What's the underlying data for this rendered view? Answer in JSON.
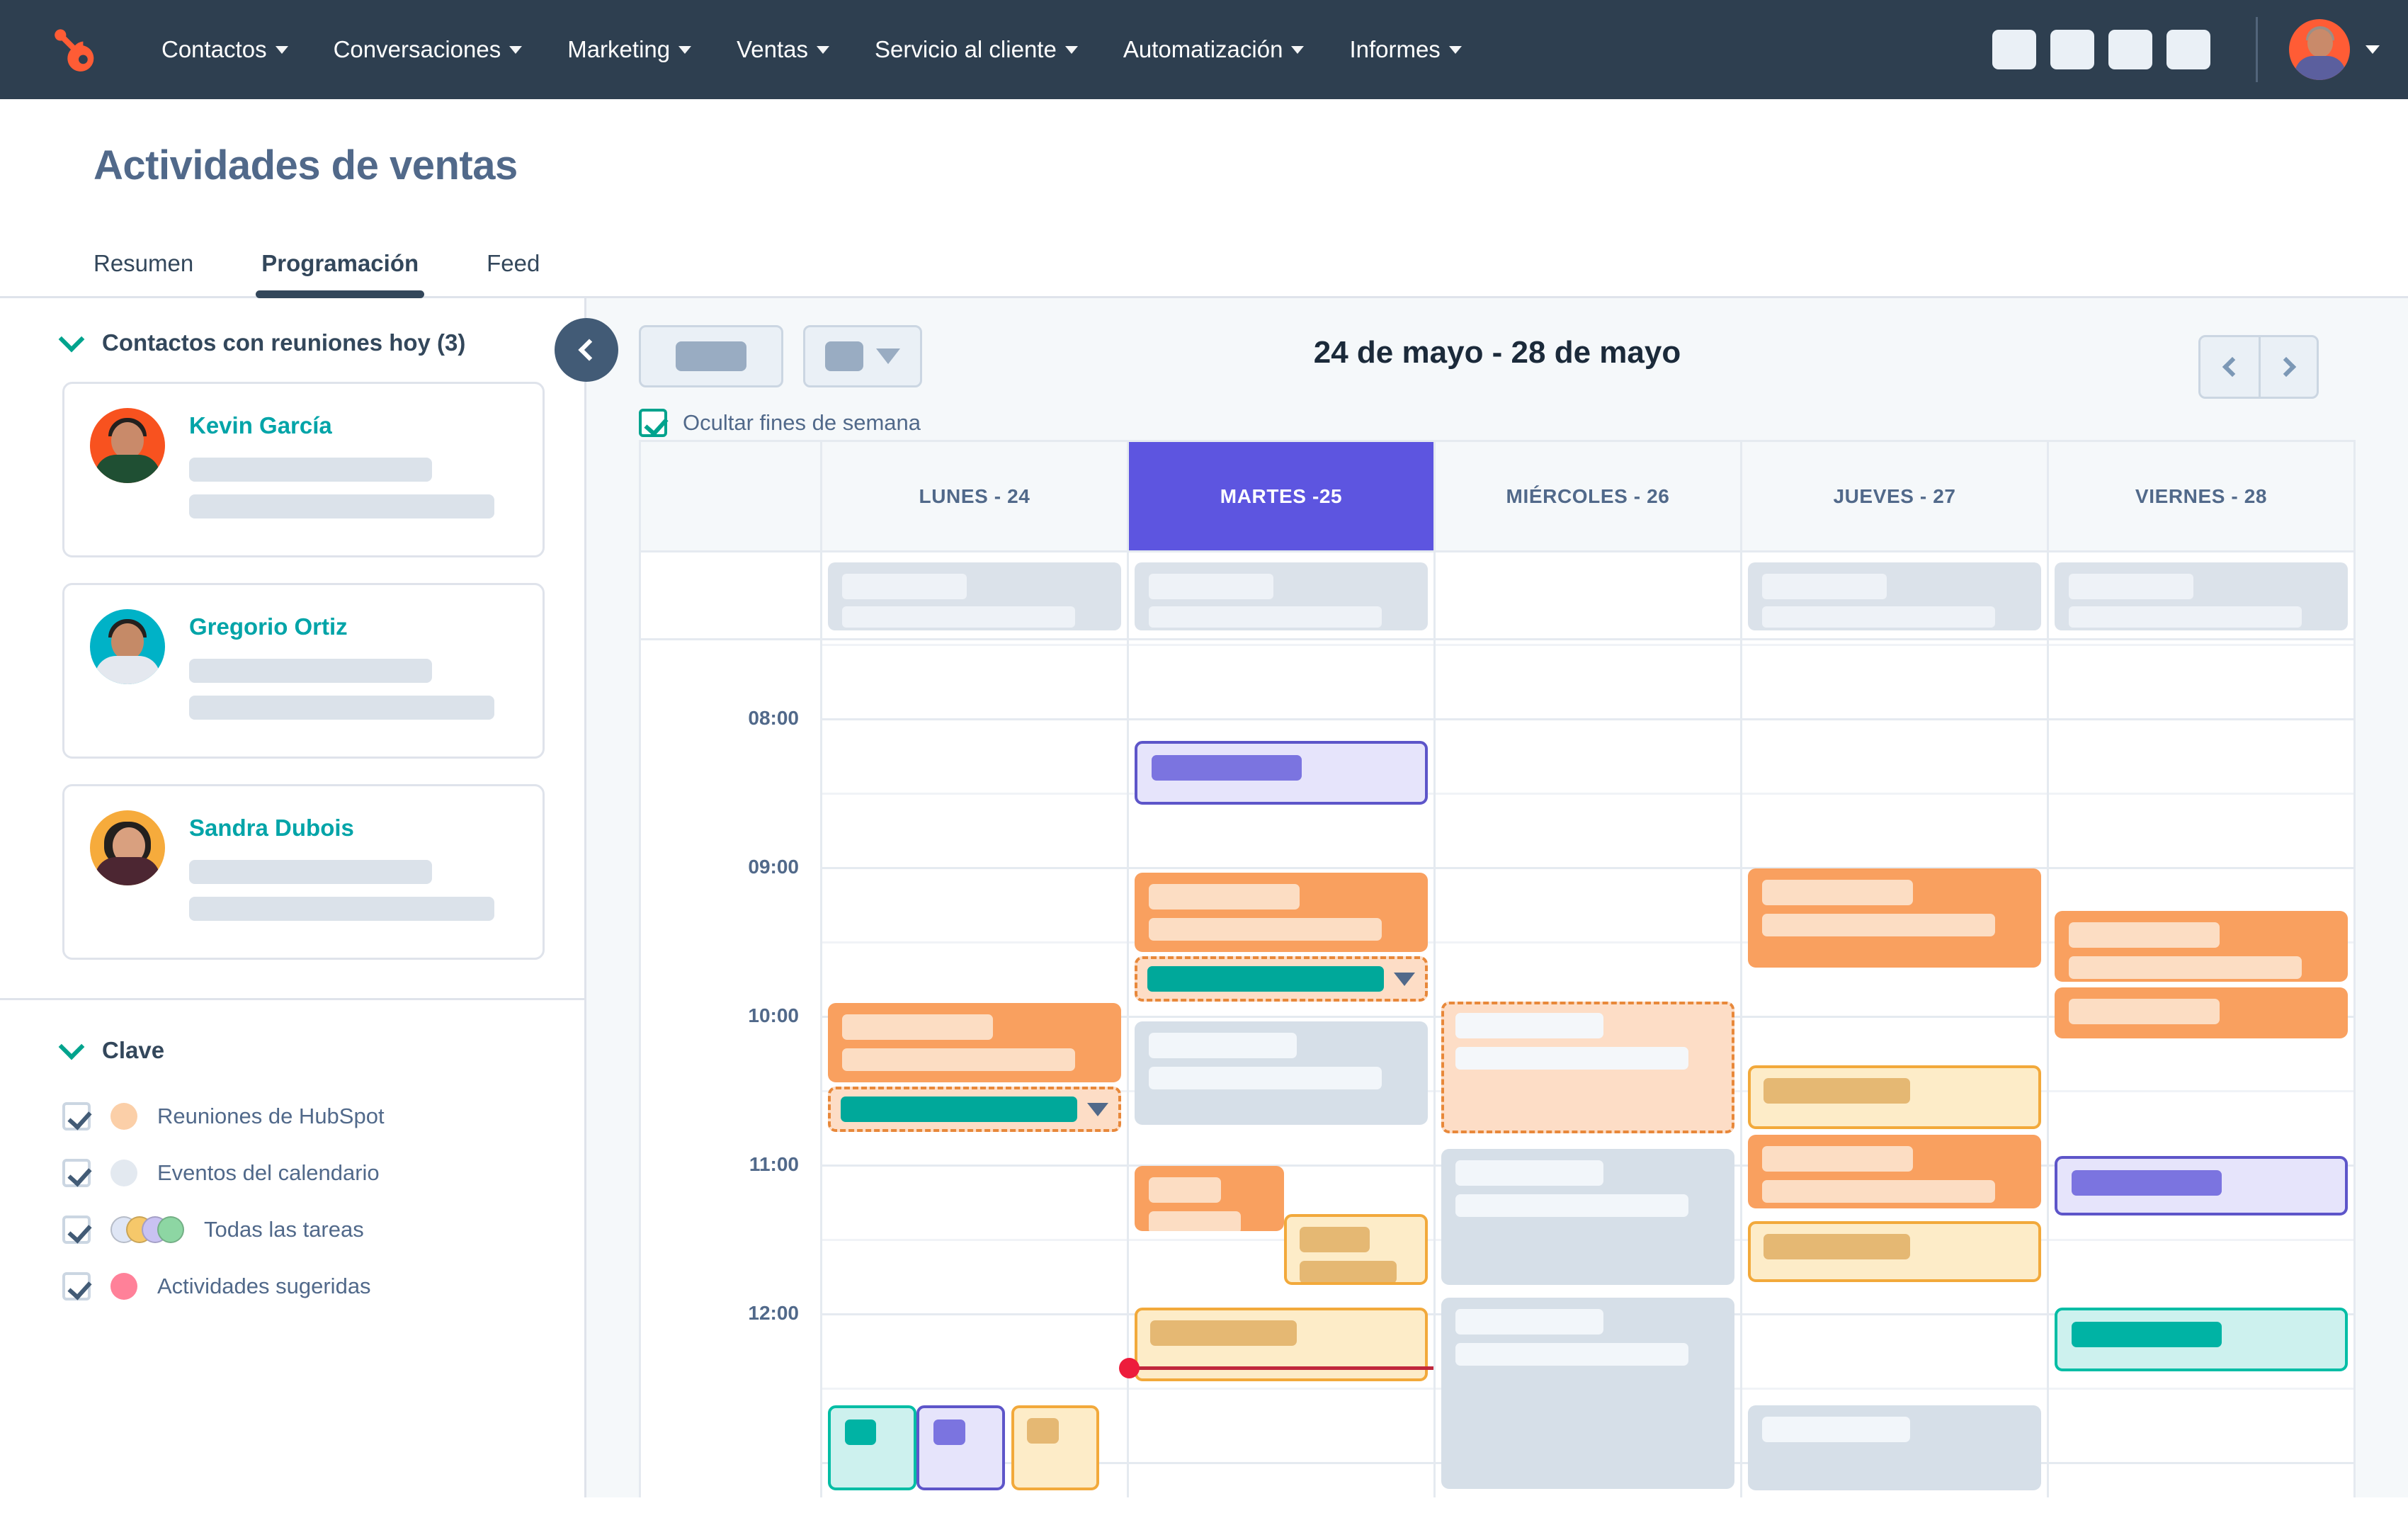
{
  "nav": {
    "logo_icon": "hubspot-sprocket-logo",
    "items": [
      {
        "label": "Contactos",
        "icon": "chevron-down-icon"
      },
      {
        "label": "Conversaciones",
        "icon": "chevron-down-icon"
      },
      {
        "label": "Marketing",
        "icon": "chevron-down-icon"
      },
      {
        "label": "Ventas",
        "icon": "chevron-down-icon"
      },
      {
        "label": "Servicio al cliente",
        "icon": "chevron-down-icon"
      },
      {
        "label": "Automatización",
        "icon": "chevron-down-icon"
      },
      {
        "label": "Informes",
        "icon": "chevron-down-icon"
      }
    ],
    "right_icon_placeholders": 4,
    "avatar_icon": "user-avatar",
    "avatar_caret_icon": "chevron-down-icon",
    "background": "#2e3f50"
  },
  "page": {
    "title": "Actividades de ventas",
    "tabs": [
      {
        "label": "Resumen",
        "active": false
      },
      {
        "label": "Programación",
        "active": true
      },
      {
        "label": "Feed",
        "active": false
      }
    ]
  },
  "sidebar": {
    "contacts_section": {
      "chevron_icon": "chevron-down-icon",
      "title": "Contactos con reuniones hoy (3)",
      "contacts": [
        {
          "name": "Kevin García",
          "avatar_bg": "#f8521f",
          "skin": "#c98a6a",
          "body": "#1f4f33"
        },
        {
          "name": "Gregorio Ortiz",
          "avatar_bg": "#00b2c7",
          "skin": "#c58a67",
          "body": "#e4e8ef"
        },
        {
          "name": "Sandra Dubois",
          "avatar_bg": "#f6ab3c",
          "skin": "#d9a07f",
          "body": "#4c2632"
        }
      ]
    },
    "legend_section": {
      "chevron_icon": "chevron-down-icon",
      "title": "Clave",
      "items": [
        {
          "label": "Reuniones de HubSpot",
          "checked": true,
          "swatch_icon": "circle-swatch",
          "colors": [
            "#fbcfa8"
          ]
        },
        {
          "label": "Eventos del calendario",
          "checked": true,
          "swatch_icon": "circle-swatch",
          "colors": [
            "#e3e9f0"
          ]
        },
        {
          "label": "Todas las tareas",
          "checked": true,
          "swatch_icon": "circle-swatch-stack",
          "colors": [
            "#dfe6f5",
            "#f6c86a",
            "#c9c2f2",
            "#8dd6a3"
          ]
        },
        {
          "label": "Actividades sugeridas",
          "checked": true,
          "swatch_icon": "circle-swatch",
          "colors": [
            "#ff8199"
          ]
        }
      ]
    }
  },
  "calendar": {
    "collapse_icon": "chevron-left-icon",
    "toolbar": {
      "button_primary_placeholder": "",
      "button_dropdown_placeholder": "",
      "dropdown_caret_icon": "caret-down-icon",
      "hide_weekends_label": "Ocultar fines de semana",
      "hide_weekends_checked": true
    },
    "week_title": "24 de mayo - 28 de mayo",
    "prev_icon": "chevron-left-icon",
    "next_icon": "chevron-right-icon",
    "view_select_caret_icon": "caret-down-icon",
    "days": [
      {
        "label": "LUNES - 24",
        "today": false
      },
      {
        "label": "MARTES -25",
        "today": true
      },
      {
        "label": "MIÉRCOLES - 26",
        "today": false
      },
      {
        "label": "JUEVES - 27",
        "today": false
      },
      {
        "label": "VIERNES - 28",
        "today": false
      }
    ],
    "allday_events": [
      {
        "day": 0,
        "type": "calendar-event"
      },
      {
        "day": 1,
        "type": "calendar-event"
      },
      {
        "day": 3,
        "type": "calendar-event"
      },
      {
        "day": 4,
        "type": "calendar-event"
      }
    ],
    "time_labels": [
      "08:00",
      "09:00",
      "10:00",
      "11:00",
      "12:00"
    ],
    "today_color": "#5d55e0",
    "now_indicator_color": "#ed1c3c",
    "event_colors": {
      "meeting": "#f9a05f",
      "suggested": "#fdddc6",
      "calendar_event": "#d6dfe8",
      "task": "#fdecc8",
      "purple_event": "#e6e4fb",
      "teal_event": "#cdf1ee"
    }
  }
}
